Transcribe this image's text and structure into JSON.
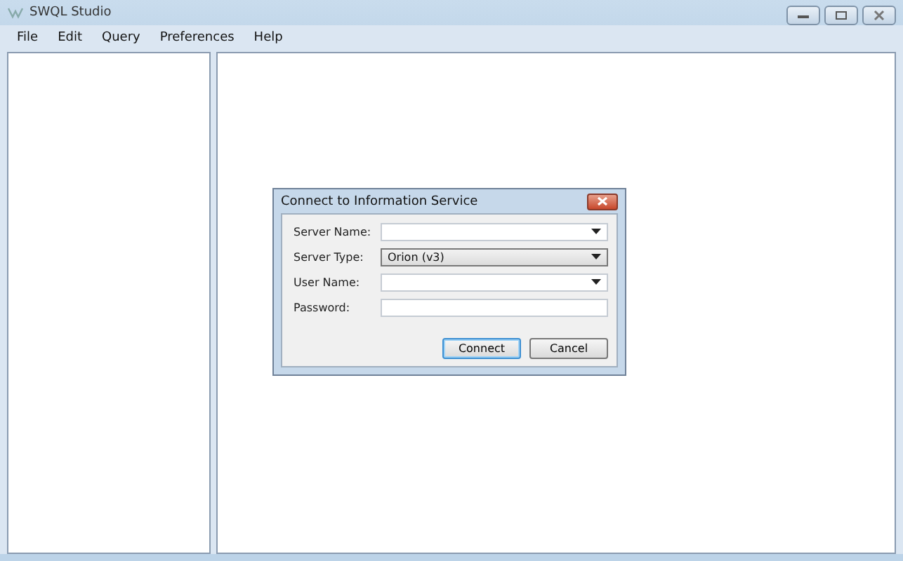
{
  "window": {
    "title": "SWQL Studio"
  },
  "menu": [
    "File",
    "Edit",
    "Query",
    "Preferences",
    "Help"
  ],
  "dialog": {
    "title": "Connect to Information Service",
    "fields": [
      {
        "label": "Server Name:",
        "kind": "combo",
        "editable": true
      },
      {
        "label": "Server Type:",
        "kind": "combo",
        "value": "Orion (v3)",
        "editable": false
      },
      {
        "label": "User Name:",
        "kind": "combo",
        "editable": true
      },
      {
        "label": "Password:",
        "kind": "text",
        "editable": true
      }
    ],
    "buttons": [
      {
        "label": "Connect",
        "default": true
      },
      {
        "label": "Cancel",
        "default": false
      }
    ]
  }
}
